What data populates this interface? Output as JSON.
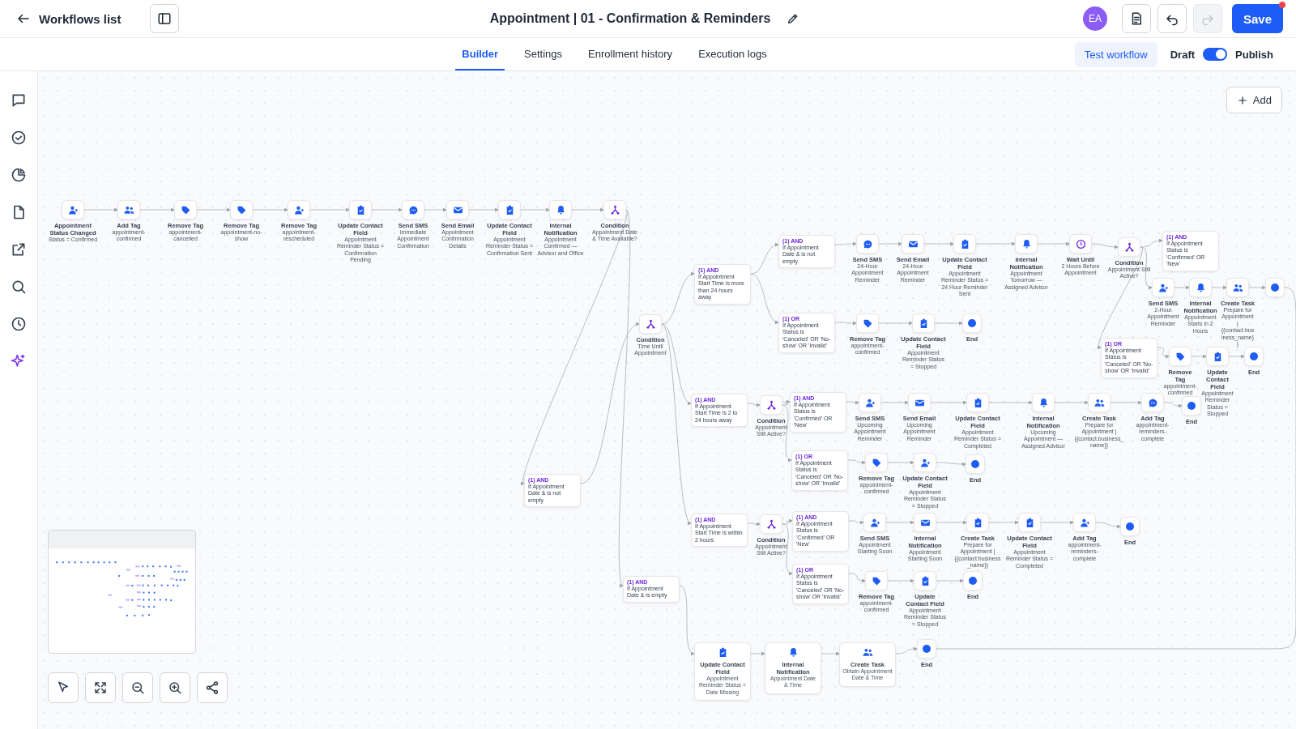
{
  "header": {
    "back_label": "Workflows list",
    "title": "Appointment | 01 - Confirmation & Reminders",
    "avatar": "EA",
    "save": {
      "label": "Save",
      "unsaved": true
    },
    "history": [
      {
        "kind": "undo",
        "disabled": false
      },
      {
        "kind": "redo",
        "disabled": true
      }
    ]
  },
  "tabs": [
    {
      "label": "Builder",
      "selected": true
    },
    {
      "label": "Settings",
      "selected": false
    },
    {
      "label": "Enrollment history",
      "selected": false
    },
    {
      "label": "Execution logs",
      "selected": false
    }
  ],
  "test_button": "Test workflow",
  "publish": {
    "off_label": "Draft",
    "on_label": "Publish",
    "on": true
  },
  "canvas": {
    "add_button": "Add",
    "workflow": [
      {
        "kind": "person",
        "title": "Appointment Status Changed",
        "detail": "Status = Confirmed"
      },
      {
        "kind": "people",
        "title": "Add Tag",
        "detail": "appointment-confirmed"
      },
      {
        "kind": "tag",
        "title": "Remove Tag",
        "detail": "appointment-cancelled"
      },
      {
        "kind": "tag",
        "title": "Remove Tag",
        "detail": "appointment-no-show"
      },
      {
        "kind": "person",
        "title": "Remove Tag",
        "detail": "appointment-rescheduled"
      },
      {
        "kind": "clipboard",
        "title": "Update Contact Field",
        "detail": "Appointment Reminder Status = Confirmation Pending"
      },
      {
        "kind": "chat",
        "title": "Send SMS",
        "detail": "Immediate Appointment Confirmation"
      },
      {
        "kind": "mail",
        "title": "Send Email",
        "detail": "Appointment Confirmation Details"
      },
      {
        "kind": "clipboard",
        "title": "Update Contact Field",
        "detail": "Appointment Reminder Status = Confirmation Sent"
      },
      {
        "kind": "bell",
        "title": "Internal Notification",
        "detail": "Appointment Confirmed — Advisor and Office"
      },
      {
        "kind": "branch",
        "title": "Condition",
        "detail": "Appointment Date & Time Available?",
        "branches": [
          [
            {
              "kind": "rule",
              "operator": "(1) AND",
              "text": "If Appointment Date & is not empty"
            },
            {
              "kind": "branch",
              "title": "Condition",
              "detail": "Time Until Appointment",
              "branches": [
                [
                  {
                    "kind": "rule",
                    "operator": "(1) AND",
                    "text": "If Appointment Start Time is more than 24 hours away",
                    "branches": [
                      [
                        {
                          "kind": "rule",
                          "operator": "(1) AND",
                          "text": "If Appointment Date & is not empty"
                        },
                        {
                          "kind": "chat",
                          "title": "Send SMS",
                          "detail": "24-Hour Appointment Reminder"
                        },
                        {
                          "kind": "mail",
                          "title": "Send Email",
                          "detail": "24-Hour Appointment Reminder"
                        },
                        {
                          "kind": "clipboard",
                          "title": "Update Contact Field",
                          "detail": "Appointment Reminder Status = 24 Hour Reminder Sent"
                        },
                        {
                          "kind": "bell",
                          "title": "Internal Notification",
                          "detail": "Appointment Tomorrow — Assigned Advisor"
                        },
                        {
                          "kind": "clock",
                          "title": "Wait Until",
                          "detail": "2 Hours Before Appointment"
                        },
                        {
                          "kind": "branch",
                          "title": "Condition",
                          "detail": "Appointment Still Active?",
                          "branches": [
                            [
                              {
                                "kind": "rule",
                                "operator": "(1) AND",
                                "text": "If Appointment Status is 'Confirmed' OR 'New'"
                              }
                            ],
                            [
                              {
                                "kind": "person",
                                "title": "Send SMS",
                                "detail": "2-Hour Appointment Reminder"
                              },
                              {
                                "kind": "bell",
                                "title": "Internal Notification",
                                "detail": "Appointment Starts in 2 Hours"
                              },
                              {
                                "kind": "people",
                                "title": "Create Task",
                                "detail": "Prepare for Appointment | {{contact.business_name}}"
                              },
                              {
                                "kind": "end"
                              }
                            ],
                            [
                              {
                                "kind": "rule",
                                "operator": "(1) OR",
                                "text": "If Appointment Status is 'Canceled' OR 'No-show' OR 'Invalid'"
                              },
                              {
                                "kind": "tag",
                                "title": "Remove Tag",
                                "detail": "appointment-confirmed"
                              },
                              {
                                "kind": "clipboard",
                                "title": "Update Contact Field",
                                "detail": "Appointment Reminder Status = Stopped"
                              },
                              {
                                "kind": "end",
                                "label": "End"
                              }
                            ]
                          ]
                        }
                      ],
                      [
                        {
                          "kind": "rule",
                          "operator": "(1) OR",
                          "text": "If Appointment Status is 'Canceled' OR 'No-show' OR 'Invalid'"
                        },
                        {
                          "kind": "tag",
                          "title": "Remove Tag",
                          "detail": "appointment-confirmed"
                        },
                        {
                          "kind": "clipboard",
                          "title": "Update Contact Field",
                          "detail": "Appointment Reminder Status = Stopped"
                        },
                        {
                          "kind": "end",
                          "label": "End"
                        }
                      ]
                    ]
                  }
                ],
                [
                  {
                    "kind": "rule",
                    "operator": "(1) AND",
                    "text": "If Appointment Start Time is 2 to 24 hours away"
                  },
                  {
                    "kind": "branch",
                    "title": "Condition",
                    "detail": "Appointment Still Active?",
                    "branches": [
                      [
                        {
                          "kind": "rule",
                          "operator": "(1) AND",
                          "text": "If Appointment Status is 'Confirmed' OR 'New'"
                        },
                        {
                          "kind": "person",
                          "title": "Send SMS",
                          "detail": "Upcoming Appointment Reminder"
                        },
                        {
                          "kind": "mail",
                          "title": "Send Email",
                          "detail": "Upcoming Appointment Reminder"
                        },
                        {
                          "kind": "clipboard",
                          "title": "Update Contact Field",
                          "detail": "Appointment Reminder Status = Completed"
                        },
                        {
                          "kind": "bell",
                          "title": "Internal Notification",
                          "detail": "Upcoming Appointment — Assigned Advisor"
                        },
                        {
                          "kind": "people",
                          "title": "Create Task",
                          "detail": "Prepare for Appointment | {{contact.business_name}}"
                        },
                        {
                          "kind": "chat",
                          "title": "Add Tag",
                          "detail": "appointment-reminders-complete"
                        },
                        {
                          "kind": "end",
                          "label": "End"
                        }
                      ],
                      [
                        {
                          "kind": "rule",
                          "operator": "(1) OR",
                          "text": "If Appointment Status is 'Canceled' OR 'No-show' OR 'Invalid'"
                        },
                        {
                          "kind": "tag",
                          "title": "Remove Tag",
                          "detail": "appointment-confirmed"
                        },
                        {
                          "kind": "person",
                          "title": "Update Contact Field",
                          "detail": "Appointment Reminder Status = Stopped"
                        },
                        {
                          "kind": "end",
                          "label": "End"
                        }
                      ]
                    ]
                  }
                ],
                [
                  {
                    "kind": "rule",
                    "operator": "(1) AND",
                    "text": "If Appointment Start Time is within 2 hours"
                  },
                  {
                    "kind": "branch",
                    "title": "Condition",
                    "detail": "Appointment Still Active?",
                    "branches": [
                      [
                        {
                          "kind": "rule",
                          "operator": "(1) AND",
                          "text": "If Appointment Status is 'Confirmed' OR 'New'"
                        },
                        {
                          "kind": "person",
                          "title": "Send SMS",
                          "detail": "Appointment Starting Soon"
                        },
                        {
                          "kind": "mail",
                          "title": "Internal Notification",
                          "detail": "Appointment Starting Soon"
                        },
                        {
                          "kind": "clipboard",
                          "title": "Create Task",
                          "detail": "Prepare for Appointment | {{contact.business_name}}"
                        },
                        {
                          "kind": "clipboard",
                          "title": "Update Contact Field",
                          "detail": "Appointment Reminder Status = Completed"
                        },
                        {
                          "kind": "person",
                          "title": "Add Tag",
                          "detail": "appointment-reminders-complete"
                        },
                        {
                          "kind": "end",
                          "label": "End"
                        }
                      ],
                      [
                        {
                          "kind": "rule",
                          "operator": "(1) OR",
                          "text": "If Appointment Status is 'Canceled' OR 'No-show' OR 'Invalid'"
                        },
                        {
                          "kind": "tag",
                          "title": "Remove Tag",
                          "detail": "appointment-confirmed"
                        },
                        {
                          "kind": "clipboard",
                          "title": "Update Contact Field",
                          "detail": "Appointment Reminder Status = Stopped"
                        },
                        {
                          "kind": "end",
                          "label": "End"
                        }
                      ]
                    ]
                  }
                ]
              ]
            }
          ],
          [
            {
              "kind": "rule",
              "operator": "(1) AND",
              "text": "If Appointment Date & is empty"
            },
            {
              "kind": "clipboard-card",
              "title": "Update Contact Field",
              "detail": "Appointment Reminder Status = Date Missing"
            },
            {
              "kind": "bell-card",
              "title": "Internal Notification",
              "detail": "Appointment Date & Time"
            },
            {
              "kind": "people-card",
              "title": "Create Task",
              "detail": "Obtain Appointment Date & Time"
            },
            {
              "kind": "end",
              "label": "End"
            }
          ]
        ]
      }
    ]
  }
}
